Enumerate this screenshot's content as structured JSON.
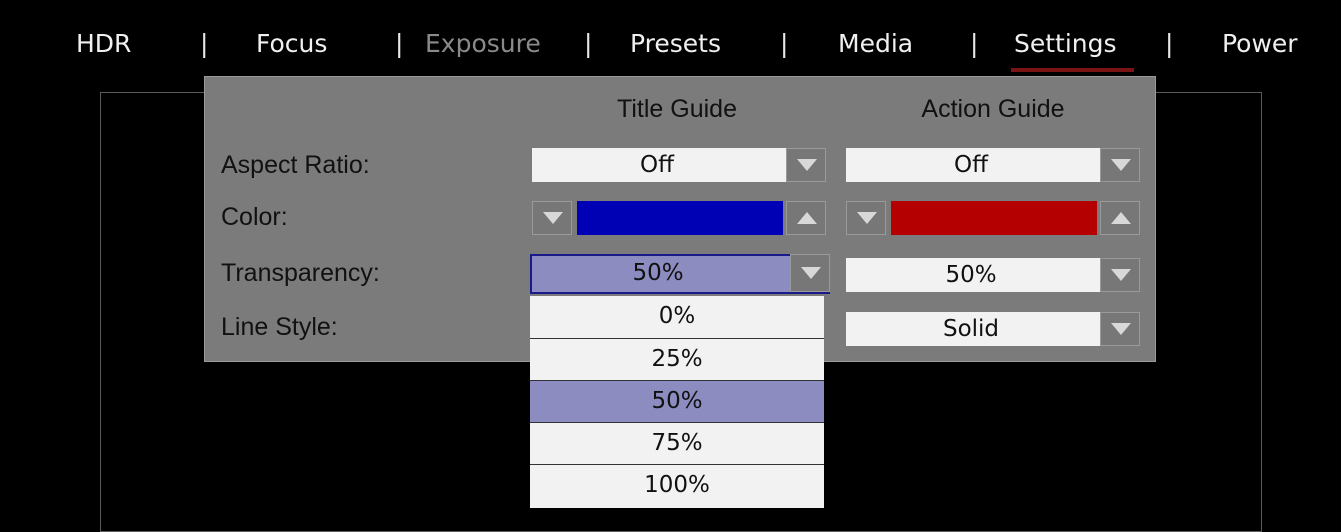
{
  "nav": {
    "items": [
      {
        "label": "HDR",
        "disabled": false
      },
      {
        "label": "Focus",
        "disabled": false
      },
      {
        "label": "Exposure",
        "disabled": true
      },
      {
        "label": "Presets",
        "disabled": false
      },
      {
        "label": "Media",
        "disabled": false
      },
      {
        "label": "Settings",
        "disabled": false,
        "active": true
      },
      {
        "label": "Power",
        "disabled": false
      }
    ],
    "separator": "|"
  },
  "panel": {
    "columns": {
      "title_guide": "Title Guide",
      "action_guide": "Action Guide"
    },
    "rows": {
      "aspect_ratio": {
        "label": "Aspect Ratio:",
        "title_value": "Off",
        "action_value": "Off"
      },
      "color": {
        "label": "Color:",
        "title_color": "#0000b4",
        "action_color": "#b40000"
      },
      "transparency": {
        "label": "Transparency:",
        "title_value": "50%",
        "action_value": "50%"
      },
      "line_style": {
        "label": "Line Style:",
        "action_value": "Solid"
      }
    }
  },
  "dropdown": {
    "options": [
      "0%",
      "25%",
      "50%",
      "75%",
      "100%"
    ],
    "selected": "50%"
  },
  "colors": {
    "panel_bg": "#7b7b7b",
    "highlight": "#8c8cc0",
    "active_tab_underline": "#7a1414"
  }
}
